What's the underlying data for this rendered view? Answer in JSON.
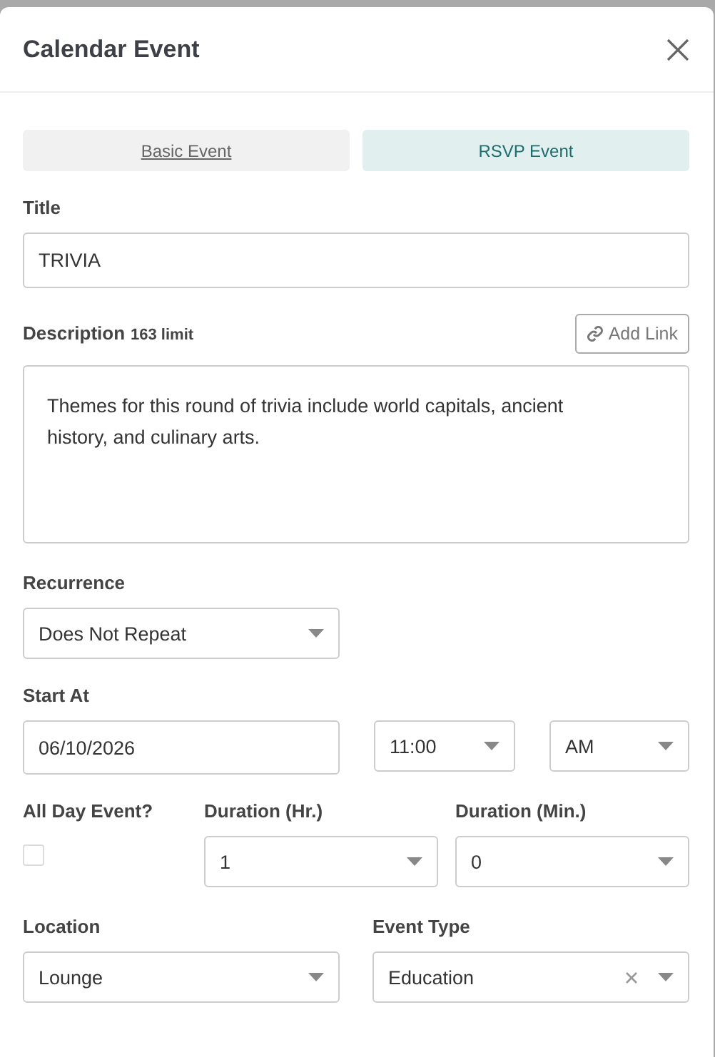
{
  "dialog": {
    "title": "Calendar Event"
  },
  "tabs": [
    {
      "label": "Basic Event",
      "selected": false
    },
    {
      "label": "RSVP Event",
      "selected": true
    }
  ],
  "title_field": {
    "label": "Title",
    "value": "TRIVIA"
  },
  "description": {
    "label": "Description",
    "limit": "163 limit",
    "add_link": "Add Link",
    "value": "Themes for this round of trivia include world capitals, ancient history, and culinary arts."
  },
  "recurrence": {
    "label": "Recurrence",
    "value": "Does Not Repeat"
  },
  "start_at": {
    "label": "Start At",
    "date": "06/10/2026",
    "time": "11:00",
    "period": "AM"
  },
  "all_day": {
    "label": "All Day Event?",
    "checked": false
  },
  "duration_hr": {
    "label": "Duration (Hr.)",
    "value": "1"
  },
  "duration_min": {
    "label": "Duration (Min.)",
    "value": "0"
  },
  "location": {
    "label": "Location",
    "value": "Lounge"
  },
  "event_type": {
    "label": "Event Type",
    "value": "Education",
    "clearable": true
  }
}
